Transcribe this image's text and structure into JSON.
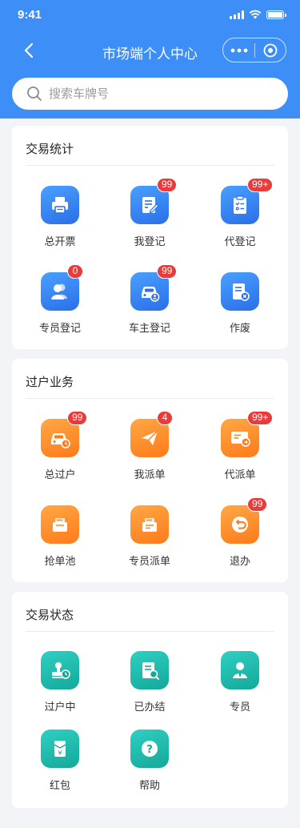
{
  "status_bar": {
    "time": "9:41"
  },
  "nav": {
    "title": "市场端个人中心"
  },
  "search": {
    "placeholder": "搜索车牌号"
  },
  "sections": [
    {
      "title": "交易统计",
      "items": [
        {
          "label": "总开票",
          "icon": "printer-icon",
          "badge": ""
        },
        {
          "label": "我登记",
          "icon": "edit-document-icon",
          "badge": "99"
        },
        {
          "label": "代登记",
          "icon": "clipboard-checklist-icon",
          "badge": "99+"
        },
        {
          "label": "专员登记",
          "icon": "users-icon",
          "badge": "0"
        },
        {
          "label": "车主登记",
          "icon": "car-owner-icon",
          "badge": "99"
        },
        {
          "label": "作废",
          "icon": "cancel-document-icon",
          "badge": ""
        }
      ]
    },
    {
      "title": "过户业务",
      "items": [
        {
          "label": "总过户",
          "icon": "car-clock-icon",
          "badge": "99"
        },
        {
          "label": "我派单",
          "icon": "paper-plane-icon",
          "badge": "4"
        },
        {
          "label": "代派单",
          "icon": "id-card-icon",
          "badge": "99+"
        },
        {
          "label": "抢单池",
          "icon": "grab-order-icon",
          "badge": ""
        },
        {
          "label": "专员派单",
          "icon": "dispatch-order-icon",
          "badge": ""
        },
        {
          "label": "退办",
          "icon": "return-icon",
          "badge": "99"
        }
      ]
    },
    {
      "title": "交易状态",
      "items": [
        {
          "label": "过户中",
          "icon": "stamp-clock-icon",
          "badge": ""
        },
        {
          "label": "已办结",
          "icon": "document-search-icon",
          "badge": ""
        },
        {
          "label": "专员",
          "icon": "agent-icon",
          "badge": ""
        },
        {
          "label": "红包",
          "icon": "red-envelope-icon",
          "badge": ""
        },
        {
          "label": "帮助",
          "icon": "help-icon",
          "badge": ""
        }
      ]
    }
  ],
  "colors": {
    "header": "#3e8ef7",
    "badge": "#ea3a3a",
    "blue_tile": "#2a6fe8",
    "orange_tile": "#ff7a1a",
    "teal_tile": "#14a89a"
  }
}
